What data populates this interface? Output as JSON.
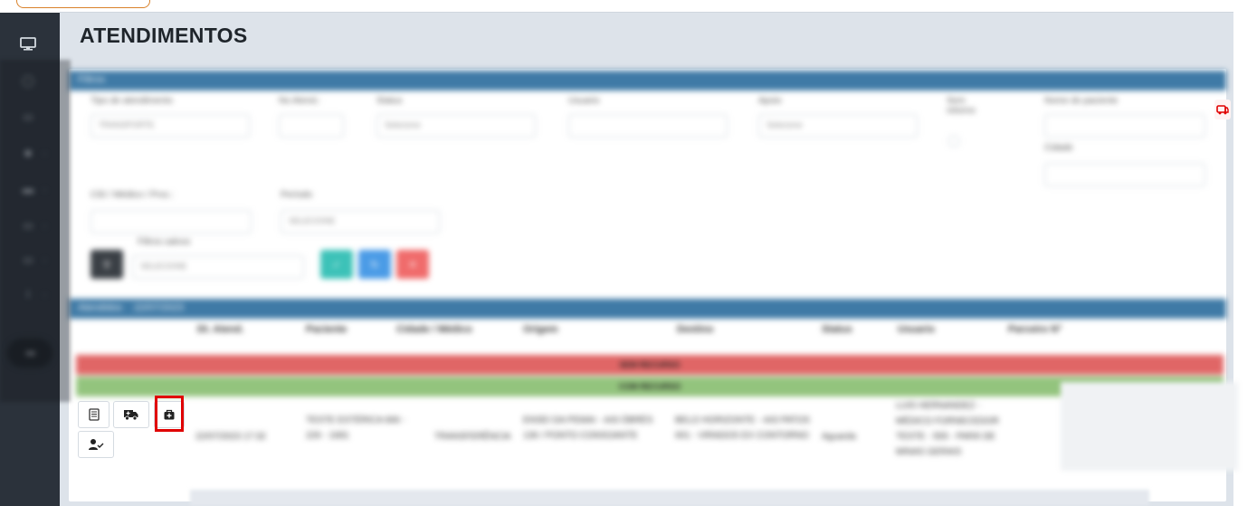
{
  "page": {
    "title": "ATENDIMENTOS"
  },
  "sidebar": {
    "items": [
      {
        "icon": "monitor-icon"
      },
      {
        "icon": "search-icon"
      },
      {
        "icon": "calendar-icon"
      },
      {
        "icon": "ambulance-icon"
      },
      {
        "icon": "bed-icon"
      },
      {
        "icon": "list-icon"
      },
      {
        "icon": "settings-icon"
      },
      {
        "icon": "info-icon"
      }
    ],
    "collapse_icon": "collapse-icon"
  },
  "filters": {
    "header": "Filtros",
    "tipo_atendimento": {
      "label": "Tipo de atendimento",
      "value": "TRANSPORTE"
    },
    "no_atend": {
      "label": "No Atend.:"
    },
    "status": {
      "label": "Status",
      "placeholder": "Selecione"
    },
    "usuario": {
      "label": "Usuario"
    },
    "apoio": {
      "label": "Apoio",
      "placeholder": "Selecione"
    },
    "sem_retorno": {
      "label": "Sem retorno"
    },
    "nome_paciente": {
      "label": "Nome do paciente"
    },
    "cidade": {
      "label": "Cidade"
    },
    "cid": {
      "label": "CID / Médico / Proc.:"
    },
    "periodo": {
      "label": "Período",
      "value": "SELECIONE"
    },
    "filtros_salvos": {
      "label": "Filtros salvos",
      "value": "SELECIONE"
    }
  },
  "table": {
    "header": "Atendidos",
    "header_date": "22/07/2023",
    "columns": [
      "Dt. Atend.",
      "Paciente",
      "Cidade / Médico",
      "Origem",
      "Destino",
      "Status",
      "Usuario",
      "Parceiro N°"
    ],
    "bar_red": "SEM RECURSO",
    "bar_green": "COM RECURSO",
    "row": {
      "date": "22/07/2023 17:32",
      "paciente": "TESTE ESTÉRICA 666 - 226 - 1681",
      "tipo": "TRANSFERÊNCIA",
      "origem": "ENSEI DA PEMAI - 443 ÓBRÉS 136 / PONTO CONSOANTE",
      "destino": "BELO HORIZONTE - 443 PATOS 001 - VIRADOS EX CONTORNO",
      "status": "Aguarda",
      "usuario": "LUIS HERNANDEZ - MÉDICO FORNECEDOR TESTE - 555 - PARÁ DE MINAS GERAIS"
    }
  },
  "actions": {
    "icons": [
      "notepad-icon",
      "ambulance-icon",
      "medical-bag-icon",
      "user-check-icon"
    ]
  }
}
